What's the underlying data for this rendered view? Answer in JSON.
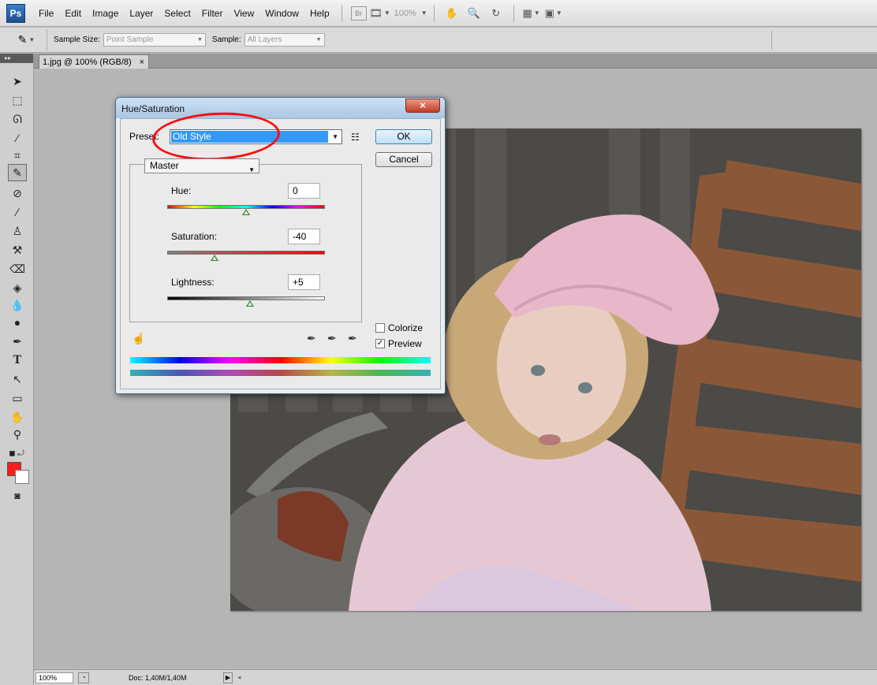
{
  "app": {
    "logo": "Ps"
  },
  "menu": [
    "File",
    "Edit",
    "Image",
    "Layer",
    "Select",
    "Filter",
    "View",
    "Window",
    "Help"
  ],
  "menubar_extras": {
    "bridge": "Br",
    "zoom": "100%"
  },
  "options": {
    "sample_size_label": "Sample Size:",
    "sample_size_value": "Point Sample",
    "sample_label": "Sample:",
    "sample_value": "All Layers"
  },
  "document": {
    "tab_title": "1.jpg @ 100% (RGB/8)",
    "tab_close": "×"
  },
  "status": {
    "zoom": "100%",
    "doc_info": "Doc: 1,40M/1,40M"
  },
  "dialog": {
    "title": "Hue/Saturation",
    "close": "×",
    "preset_label": "Preset:",
    "preset_value": "Old Style",
    "ok": "OK",
    "cancel": "Cancel",
    "channel": "Master",
    "hue_label": "Hue:",
    "hue_value": "0",
    "saturation_label": "Saturation:",
    "saturation_value": "-40",
    "lightness_label": "Lightness:",
    "lightness_value": "+5",
    "colorize_label": "Colorize",
    "preview_label": "Preview",
    "colorize_checked": false,
    "preview_checked": true
  },
  "colors": {
    "foreground": "#ff1e1e",
    "background": "#ffffff",
    "selection": "#3399ff",
    "annotation": "#ff0a0a"
  }
}
